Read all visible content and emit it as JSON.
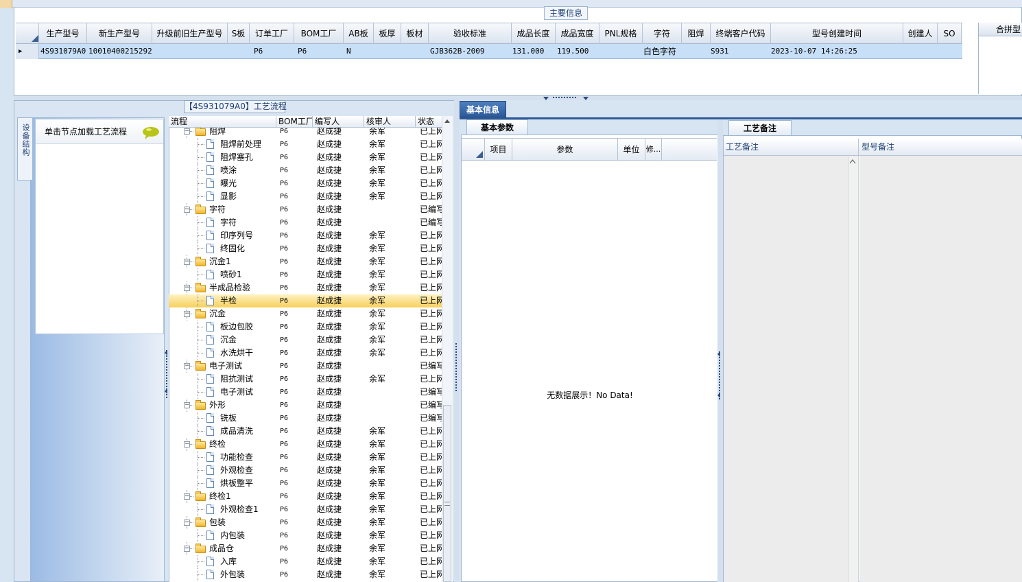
{
  "main_info": {
    "group_title": "主要信息",
    "columns": [
      "生产型号",
      "新生产型号",
      "升级前旧生产型号",
      "S板",
      "订单工厂",
      "BOM工厂",
      "AB板",
      "板厚",
      "板材",
      "验收标准",
      "成品长度",
      "成品宽度",
      "PNL规格",
      "字符",
      "阻焊",
      "终端客户代码",
      "型号创建时间",
      "创建人",
      "SO"
    ],
    "row": {
      "prod_model": "4S931079A0",
      "new_prod_model": "10010400215292",
      "old_model": "",
      "s_board": "",
      "order_factory": "P6",
      "bom_factory": "P6",
      "ab_board": "N",
      "thickness": "",
      "material": "",
      "accept_std": "GJB362B-2009",
      "length": "131.000",
      "width": "119.500",
      "pnl": "",
      "char": "白色字符",
      "solder": "",
      "customer_code": "S931",
      "created_time": "2023-10-07 14:26:25",
      "creator": "",
      "so": ""
    },
    "right_panel_header": "合拼型"
  },
  "flow": {
    "title": "【4S931079A0】工艺流程",
    "side_tab": "设备结构",
    "equip_hint": "单击节点加载工艺流程",
    "columns": [
      "流程",
      "BOM工厂",
      "编写人",
      "核审人",
      "状态"
    ],
    "rows": [
      {
        "name": "阻焊",
        "type": "folder",
        "level": 0,
        "bom": "P6",
        "writer": "赵成捷",
        "reviewer": "余军",
        "status": "已上网"
      },
      {
        "name": "阻焊前处理",
        "type": "doc",
        "level": 1,
        "bom": "P6",
        "writer": "赵成捷",
        "reviewer": "余军",
        "status": "已上网"
      },
      {
        "name": "阻焊塞孔",
        "type": "doc",
        "level": 1,
        "bom": "P6",
        "writer": "赵成捷",
        "reviewer": "余军",
        "status": "已上网"
      },
      {
        "name": "喷涂",
        "type": "doc",
        "level": 1,
        "bom": "P6",
        "writer": "赵成捷",
        "reviewer": "余军",
        "status": "已上网"
      },
      {
        "name": "曝光",
        "type": "doc",
        "level": 1,
        "bom": "P6",
        "writer": "赵成捷",
        "reviewer": "余军",
        "status": "已上网"
      },
      {
        "name": "显影",
        "type": "doc",
        "level": 1,
        "bom": "P6",
        "writer": "赵成捷",
        "reviewer": "余军",
        "status": "已上网"
      },
      {
        "name": "字符",
        "type": "folder",
        "level": 0,
        "bom": "P6",
        "writer": "赵成捷",
        "reviewer": "",
        "status": "已编写"
      },
      {
        "name": "字符",
        "type": "doc",
        "level": 1,
        "bom": "P6",
        "writer": "赵成捷",
        "reviewer": "",
        "status": "已编写"
      },
      {
        "name": "印序列号",
        "type": "doc",
        "level": 1,
        "bom": "P6",
        "writer": "赵成捷",
        "reviewer": "余军",
        "status": "已上网"
      },
      {
        "name": "终固化",
        "type": "doc",
        "level": 1,
        "bom": "P6",
        "writer": "赵成捷",
        "reviewer": "余军",
        "status": "已上网"
      },
      {
        "name": "沉金1",
        "type": "folder",
        "level": 0,
        "bom": "P6",
        "writer": "赵成捷",
        "reviewer": "余军",
        "status": "已上网"
      },
      {
        "name": "喷砂1",
        "type": "doc",
        "level": 1,
        "bom": "P6",
        "writer": "赵成捷",
        "reviewer": "余军",
        "status": "已上网"
      },
      {
        "name": "半成品检验",
        "type": "folder",
        "level": 0,
        "bom": "P6",
        "writer": "赵成捷",
        "reviewer": "余军",
        "status": "已上网"
      },
      {
        "name": "半检",
        "type": "doc",
        "level": 1,
        "bom": "P6",
        "writer": "赵成捷",
        "reviewer": "余军",
        "status": "已上网",
        "selected": true
      },
      {
        "name": "沉金",
        "type": "folder",
        "level": 0,
        "bom": "P6",
        "writer": "赵成捷",
        "reviewer": "余军",
        "status": "已上网"
      },
      {
        "name": "板边包胶",
        "type": "doc",
        "level": 1,
        "bom": "P6",
        "writer": "赵成捷",
        "reviewer": "余军",
        "status": "已上网"
      },
      {
        "name": "沉金",
        "type": "doc",
        "level": 1,
        "bom": "P6",
        "writer": "赵成捷",
        "reviewer": "余军",
        "status": "已上网"
      },
      {
        "name": "水洗烘干",
        "type": "doc",
        "level": 1,
        "bom": "P6",
        "writer": "赵成捷",
        "reviewer": "余军",
        "status": "已上网"
      },
      {
        "name": "电子测试",
        "type": "folder",
        "level": 0,
        "bom": "P6",
        "writer": "赵成捷",
        "reviewer": "",
        "status": "已编写"
      },
      {
        "name": "阻抗测试",
        "type": "doc",
        "level": 1,
        "bom": "P6",
        "writer": "赵成捷",
        "reviewer": "余军",
        "status": "已上网"
      },
      {
        "name": "电子测试",
        "type": "doc",
        "level": 1,
        "bom": "P6",
        "writer": "赵成捷",
        "reviewer": "",
        "status": "已编写"
      },
      {
        "name": "外形",
        "type": "folder",
        "level": 0,
        "bom": "P6",
        "writer": "赵成捷",
        "reviewer": "",
        "status": "已编写"
      },
      {
        "name": "铣板",
        "type": "doc",
        "level": 1,
        "bom": "P6",
        "writer": "赵成捷",
        "reviewer": "",
        "status": "已编写"
      },
      {
        "name": "成品清洗",
        "type": "doc",
        "level": 1,
        "bom": "P6",
        "writer": "赵成捷",
        "reviewer": "余军",
        "status": "已上网"
      },
      {
        "name": "终检",
        "type": "folder",
        "level": 0,
        "bom": "P6",
        "writer": "赵成捷",
        "reviewer": "余军",
        "status": "已上网"
      },
      {
        "name": "功能检查",
        "type": "doc",
        "level": 1,
        "bom": "P6",
        "writer": "赵成捷",
        "reviewer": "余军",
        "status": "已上网"
      },
      {
        "name": "外观检查",
        "type": "doc",
        "level": 1,
        "bom": "P6",
        "writer": "赵成捷",
        "reviewer": "余军",
        "status": "已上网"
      },
      {
        "name": "烘板整平",
        "type": "doc",
        "level": 1,
        "bom": "P6",
        "writer": "赵成捷",
        "reviewer": "余军",
        "status": "已上网"
      },
      {
        "name": "终检1",
        "type": "folder",
        "level": 0,
        "bom": "P6",
        "writer": "赵成捷",
        "reviewer": "余军",
        "status": "已上网"
      },
      {
        "name": "外观检查1",
        "type": "doc",
        "level": 1,
        "bom": "P6",
        "writer": "赵成捷",
        "reviewer": "余军",
        "status": "已上网"
      },
      {
        "name": "包装",
        "type": "folder",
        "level": 0,
        "bom": "P6",
        "writer": "赵成捷",
        "reviewer": "余军",
        "status": "已上网"
      },
      {
        "name": "内包装",
        "type": "doc",
        "level": 1,
        "bom": "P6",
        "writer": "赵成捷",
        "reviewer": "余军",
        "status": "已上网"
      },
      {
        "name": "成品仓",
        "type": "folder",
        "level": 0,
        "bom": "P6",
        "writer": "赵成捷",
        "reviewer": "余军",
        "status": "已上网"
      },
      {
        "name": "入库",
        "type": "doc",
        "level": 1,
        "bom": "P6",
        "writer": "赵成捷",
        "reviewer": "余军",
        "status": "已上网"
      },
      {
        "name": "外包装",
        "type": "doc",
        "level": 1,
        "bom": "P6",
        "writer": "赵成捷",
        "reviewer": "余军",
        "status": "已上网"
      }
    ]
  },
  "basic": {
    "tab_label": "基本信息",
    "param_tab": "基本参数",
    "param_columns": [
      "项目",
      "参数",
      "单位",
      "修..."
    ],
    "no_data": "无数据展示！No Data!",
    "remark_tab": "工艺备注",
    "remark_columns": [
      "工艺备注",
      "型号备注"
    ]
  }
}
